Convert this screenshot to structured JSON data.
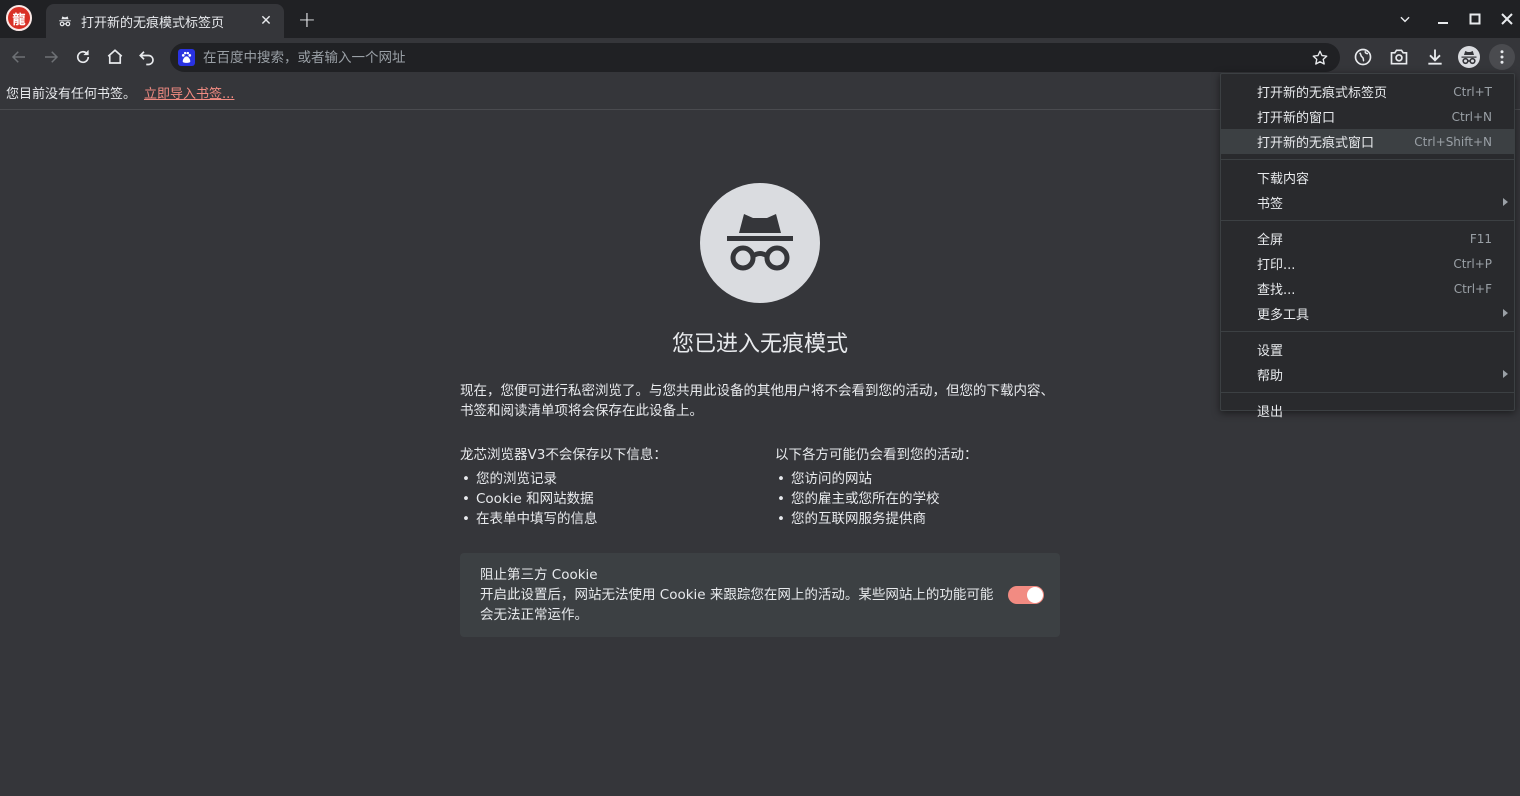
{
  "window": {
    "app_logo_text": "龍",
    "tab_title": "打开新的无痕模式标签页",
    "tab_close": "✕",
    "new_tab": "+"
  },
  "toolbar": {
    "omnibox_placeholder": "在百度中搜索，或者输入一个网址",
    "search_engine": "baidu"
  },
  "bookmarks": {
    "no_bookmarks_text": "您目前没有任何书签。",
    "import_link": "立即导入书签..."
  },
  "main": {
    "heading": "您已进入无痕模式",
    "intro": "现在，您便可进行私密浏览了。与您共用此设备的其他用户将不会看到您的活动，但您的下载内容、书签和阅读清单项将会保存在此设备上。",
    "not_saved": {
      "title": "龙芯浏览器V3不会保存以下信息：",
      "items": [
        "您的浏览记录",
        "Cookie 和网站数据",
        "在表单中填写的信息"
      ]
    },
    "may_see": {
      "title": "以下各方可能仍会看到您的活动：",
      "items": [
        "您访问的网站",
        "您的雇主或您所在的学校",
        "您的互联网服务提供商"
      ]
    },
    "cookie": {
      "title": "阻止第三方 Cookie",
      "description": "开启此设置后，网站无法使用 Cookie 来跟踪您在网上的活动。某些网站上的功能可能会无法正常运作。",
      "enabled": true
    }
  },
  "menu": {
    "items": [
      {
        "label": "打开新的无痕式标签页",
        "shortcut": "Ctrl+T"
      },
      {
        "label": "打开新的窗口",
        "shortcut": "Ctrl+N"
      },
      {
        "label": "打开新的无痕式窗口",
        "shortcut": "Ctrl+Shift+N"
      },
      {
        "label": "下载内容",
        "shortcut": ""
      },
      {
        "label": "书签",
        "shortcut": ""
      },
      {
        "label": "全屏",
        "shortcut": "F11"
      },
      {
        "label": "打印...",
        "shortcut": "Ctrl+P"
      },
      {
        "label": "查找...",
        "shortcut": "Ctrl+F"
      },
      {
        "label": "更多工具",
        "shortcut": ""
      },
      {
        "label": "设置",
        "shortcut": ""
      },
      {
        "label": "帮助",
        "shortcut": ""
      },
      {
        "label": "退出",
        "shortcut": ""
      }
    ]
  },
  "colors": {
    "background": "#35363a",
    "titlebar": "#202124",
    "accent_link": "#f28b82",
    "toggle_on": "#f28b82",
    "menu_bg": "#292a2d"
  }
}
